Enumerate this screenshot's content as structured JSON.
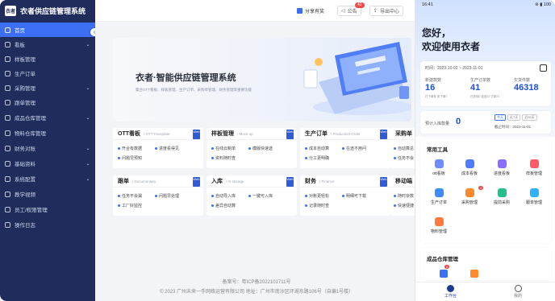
{
  "sidebar": {
    "logo_text": "衣者",
    "title": "衣者供应链管理系统",
    "collapse_glyph": "‹",
    "items": [
      {
        "label": "首页",
        "chevron": ""
      },
      {
        "label": "看板",
        "chevron": "⌄"
      },
      {
        "label": "样板管理",
        "chevron": ""
      },
      {
        "label": "生产订单",
        "chevron": ""
      },
      {
        "label": "采购管理",
        "chevron": "⌄"
      },
      {
        "label": "跟单管理",
        "chevron": ""
      },
      {
        "label": "成品仓库管理",
        "chevron": "⌄"
      },
      {
        "label": "物料仓库管理",
        "chevron": ""
      },
      {
        "label": "财务对账",
        "chevron": "⌄"
      },
      {
        "label": "基础资料",
        "chevron": "⌄"
      },
      {
        "label": "系统配置",
        "chevron": "⌄"
      },
      {
        "label": "教学视频",
        "chevron": ""
      },
      {
        "label": "员工/权限管理",
        "chevron": ""
      },
      {
        "label": "操作日志",
        "chevron": ""
      }
    ]
  },
  "topbar": {
    "share": "分享有奖",
    "notice": "公告",
    "notice_count": "42",
    "export": "导出中心"
  },
  "hero": {
    "title": "衣者·智能供应链管理系统",
    "subtitle": "集合OTT看板、样板管理、生产订单、采购单管理、财务管理等重要功能"
  },
  "cards": [
    {
      "title": "OTT看板",
      "sub": "/ OTT Faceplate",
      "tag": "Web",
      "items": [
        "开合有数据",
        "进度看得见",
        "问题早预知"
      ]
    },
    {
      "title": "样板管理",
      "sub": "/ Mock-up",
      "tag": "Web",
      "items": [
        "在线云制单",
        "模版快速选",
        "资料随时查"
      ]
    },
    {
      "title": "生产订单",
      "sub": "/ Production Order",
      "tag": "Web",
      "items": [
        "成本自动算",
        "在途不用问",
        "分工更明确"
      ]
    },
    {
      "title": "采购单",
      "sub": "",
      "tag": "",
      "items": [
        "自动算总",
        "任务不会"
      ]
    },
    {
      "title": "跟单",
      "sub": "/ Documentary",
      "tag": "Web",
      "items": [
        "任务不会漏",
        "问题早处理",
        "工厂好监控"
      ]
    },
    {
      "title": "入库",
      "sub": "/ In storage",
      "tag": "Web",
      "items": [
        "自动导入库",
        "一键可入库",
        "差异自动算"
      ]
    },
    {
      "title": "财务",
      "sub": "/ Finance",
      "tag": "Web",
      "items": [
        "对账更轻松",
        "明细可下载",
        "记录随时查"
      ]
    },
    {
      "title": "移动端",
      "sub": "/ M",
      "tag": "",
      "items": [
        "随时杂数",
        "快速便捷"
      ]
    }
  ],
  "footer": {
    "icp": "备案号：粤ICP备2022101711号",
    "copyright": "© 2023 广州未来一手网络运营有限公司 地址：广州市南沙区环湖东路106号（自编1号楼）"
  },
  "phone": {
    "time": "16:41",
    "status_right": "⊛ ▮ 100",
    "greet1": "您好，",
    "greet2": "欢迎使用衣者",
    "date_range": "时间：2023-10-02 ~ 2023-11-01",
    "stats": [
      {
        "label": "新建款数",
        "value": "16",
        "note": "打下单件  未下单7"
      },
      {
        "label": "生产订单数",
        "value": "41",
        "note": "已完成0  延迟22  订单21"
      },
      {
        "label": "欠货件数",
        "value": "46318",
        "note": ""
      }
    ],
    "inbound_label": "预计入库款量",
    "inbound_value": "0",
    "seg": [
      "今天",
      "近7天",
      "近30天"
    ],
    "deadline": "截止时间：2023-11-01",
    "tools_title": "常用工具",
    "tools": [
      {
        "label": "ott看板",
        "color": "#6c8cff"
      },
      {
        "label": "成本看板",
        "color": "#4f7cff"
      },
      {
        "label": "进度看板",
        "color": "#8a6cff"
      },
      {
        "label": "样板管理",
        "color": "#ff5a6a"
      },
      {
        "label": "生产订单",
        "color": "#3d8bff"
      },
      {
        "label": "采购管理",
        "color": "#ff8a2b"
      },
      {
        "label": "提前采购",
        "color": "#22c08a"
      },
      {
        "label": "跟单管理",
        "color": "#2fb1ff"
      },
      {
        "label": "物料管理",
        "color": "#ff7a3c"
      }
    ],
    "purchase_badge": "1",
    "warehouse_title": "成品仓库管理",
    "warehouse_badge": "2",
    "tab_work": "工作台",
    "tab_me": "我的"
  }
}
